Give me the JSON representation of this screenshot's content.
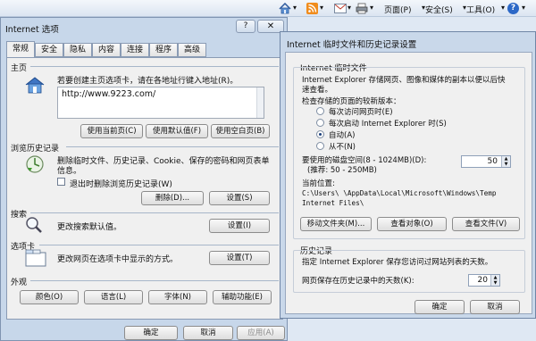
{
  "ie_toolbar": {
    "page": "页面(P)",
    "safety": "安全(S)",
    "tools": "工具(O)",
    "arrow": "▾",
    "help_glyph": "?"
  },
  "options": {
    "title": "Internet 选项",
    "help_glyph": "?",
    "tabs": [
      "常规",
      "安全",
      "隐私",
      "内容",
      "连接",
      "程序",
      "高级"
    ],
    "home": {
      "heading": "主页",
      "desc": "若要创建主页选项卡，请在各地址行键入地址(R)。",
      "url": "http://www.9223.com/",
      "btn_current": "使用当前页(C)",
      "btn_default": "使用默认值(F)",
      "btn_blank": "使用空白页(B)"
    },
    "history": {
      "heading": "浏览历史记录",
      "desc_line1": "删除临时文件、历史记录、Cookie、保存的密码和网页表单",
      "desc_line2": "信息。",
      "checkbox_label": "退出时删除浏览历史记录(W)",
      "btn_delete": "删除(D)...",
      "btn_settings": "设置(S)"
    },
    "search": {
      "heading": "搜索",
      "desc": "更改搜索默认值。",
      "btn_settings": "设置(I)"
    },
    "tabs_section": {
      "heading": "选项卡",
      "desc": "更改网页在选项卡中显示的方式。",
      "btn_settings": "设置(T)"
    },
    "appearance": {
      "heading": "外观",
      "btn_colors": "颜色(O)",
      "btn_languages": "语言(L)",
      "btn_fonts": "字体(N)",
      "btn_accessibility": "辅助功能(E)"
    },
    "footer": {
      "ok": "确定",
      "cancel": "取消",
      "apply": "应用(A)"
    }
  },
  "temp_dialog": {
    "title": "Internet 临时文件和历史记录设置",
    "group_temp": "Internet 临时文件",
    "desc_line1": "Internet Explorer 存储网页、图像和媒体的副本以便以后快",
    "desc_line2": "速查看。",
    "check_label": "检查存储的页面的较新版本：",
    "radio_options": [
      "每次访问网页时(E)",
      "每次启动 Internet Explorer 时(S)",
      "自动(A)",
      "从不(N)"
    ],
    "selected_radio": "自动(A)",
    "disk_label_line1": "要使用的磁盘空间(8 - 1024MB)(D):",
    "disk_label_line2": "(推荐: 50 - 250MB)",
    "disk_value": "50",
    "location_label": "当前位置:",
    "location_line1": "C:\\Users\\        \\AppData\\Local\\Microsoft\\Windows\\Temp",
    "location_line2": "Internet Files\\",
    "btn_move": "移动文件夹(M)...",
    "btn_view_objects": "查看对象(O)",
    "btn_view_files": "查看文件(V)",
    "group_history": "历史记录",
    "history_desc": "指定 Internet Explorer 保存您访问过网站列表的天数。",
    "days_label": "网页保存在历史记录中的天数(K):",
    "days_value": "20",
    "ok": "确定",
    "cancel": "取消"
  }
}
